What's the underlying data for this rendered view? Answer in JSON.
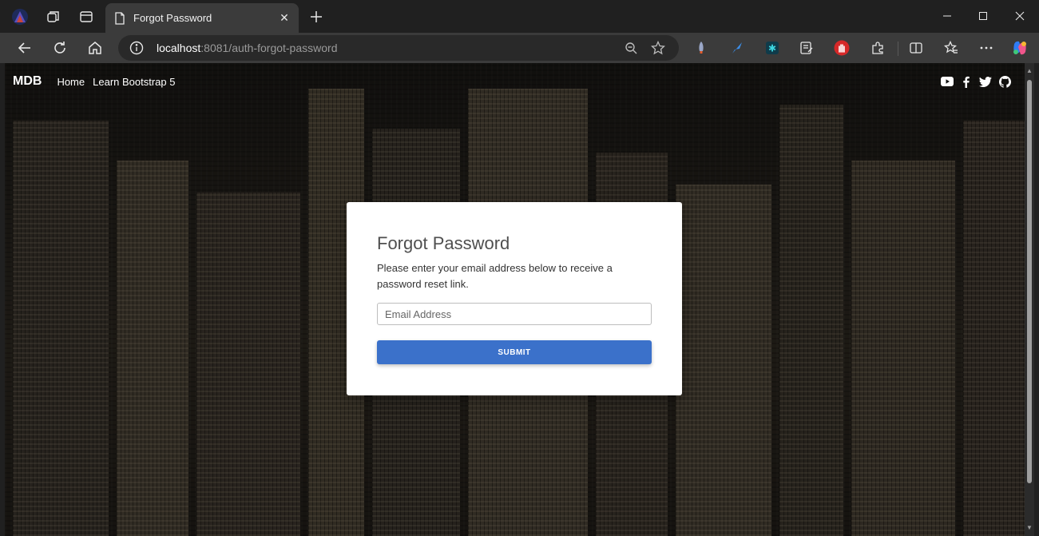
{
  "browser": {
    "tab_title": "Forgot Password",
    "tab_close_glyph": "✕",
    "new_tab_glyph": "+",
    "address": {
      "host": "localhost",
      "rest": ":8081/auth-forgot-password"
    },
    "icons": {
      "profile": "profile-icon",
      "workspaces": "workspaces-icon",
      "tab_actions": "tab-actions-icon",
      "back": "back-arrow-icon",
      "reload": "reload-icon",
      "home": "home-icon",
      "info": "site-info-icon",
      "zoom": "zoom-out-icon",
      "favorite": "star-icon"
    },
    "window_controls": [
      "minimize",
      "maximize",
      "close"
    ]
  },
  "navbar": {
    "brand": "MDB",
    "links": [
      "Home",
      "Learn Bootstrap 5"
    ],
    "social": [
      "youtube-icon",
      "facebook-icon",
      "twitter-icon",
      "github-icon"
    ]
  },
  "card": {
    "title": "Forgot Password",
    "description": "Please enter your email address below to receive a password reset link.",
    "email_placeholder": "Email Address",
    "email_value": "",
    "submit_label": "SUBMIT"
  },
  "colors": {
    "primary": "#3b71ca",
    "card_bg": "#ffffff",
    "chrome_bg": "#202020",
    "toolbar_bg": "#3b3b3b"
  }
}
